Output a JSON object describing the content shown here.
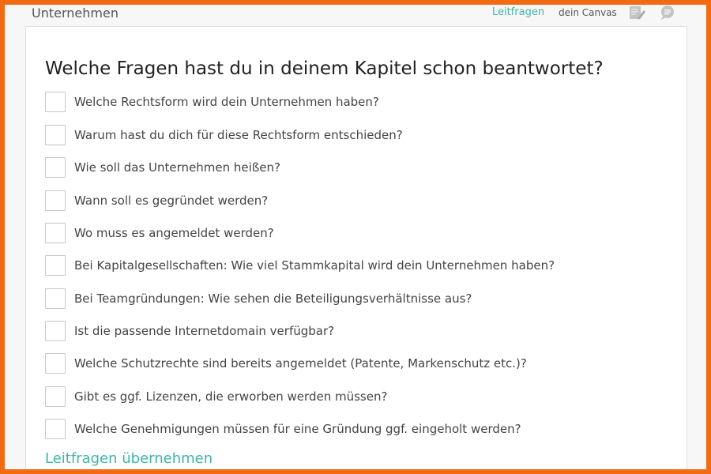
{
  "header": {
    "section_title": "Unternehmen",
    "nav_leitfragen": "Leitfragen",
    "nav_canvas": "dein Canvas",
    "icons": [
      "edit-note-icon",
      "comment-icon"
    ]
  },
  "card": {
    "heading": "Welche Fragen hast du in deinem Kapitel schon beantwortet?",
    "questions": [
      {
        "label": "Welche Rechtsform wird dein Unternehmen haben?",
        "checked": false
      },
      {
        "label": "Warum hast du dich für diese Rechtsform entschieden?",
        "checked": false
      },
      {
        "label": "Wie soll das Unternehmen heißen?",
        "checked": false
      },
      {
        "label": "Wann soll es gegründet werden?",
        "checked": false
      },
      {
        "label": "Wo muss es angemeldet werden?",
        "checked": false
      },
      {
        "label": "Bei Kapitalgesellschaften: Wie viel Stammkapital wird dein Unternehmen haben?",
        "checked": false
      },
      {
        "label": "Bei Teamgründungen: Wie sehen die Beteiligungsverhältnisse aus?",
        "checked": false
      },
      {
        "label": "Ist die passende Internetdomain verfügbar?",
        "checked": false
      },
      {
        "label": "Welche Schutzrechte sind bereits angemeldet (Patente, Markenschutz etc.)?",
        "checked": false
      },
      {
        "label": "Gibt es ggf. Lizenzen, die erworben werden müssen?",
        "checked": false
      },
      {
        "label": "Welche Genehmigungen müssen für eine Gründung ggf. eingeholt werden?",
        "checked": false
      }
    ],
    "take_over_link": "Leitfragen übernehmen"
  },
  "colors": {
    "accent": "#3fb6a8",
    "frame_border": "#f26a12",
    "text": "#444444"
  }
}
